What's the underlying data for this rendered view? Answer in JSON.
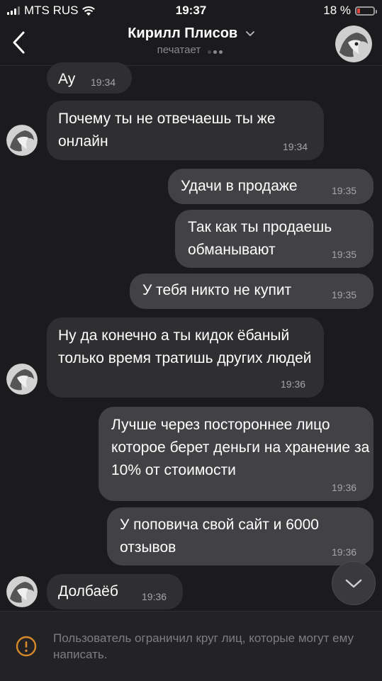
{
  "status_bar": {
    "carrier": "MTS RUS",
    "time": "19:37",
    "battery_text": "18 %",
    "battery_level": 0.18
  },
  "header": {
    "back_icon": "chevron-left-icon",
    "contact_name": "Кирилл Плисов",
    "status": "печатает",
    "avatar_icon": "contact-avatar"
  },
  "messages": [
    {
      "dir": "in",
      "text": "Ау",
      "time": "19:34"
    },
    {
      "dir": "in",
      "text": "Почему ты не отвечаешь ты же онлайн",
      "time": "19:34"
    },
    {
      "dir": "out",
      "text": "Удачи в продаже",
      "time": "19:35"
    },
    {
      "dir": "out",
      "text": "Так как ты продаешь обманывают",
      "time": "19:35"
    },
    {
      "dir": "out",
      "text": "У тебя никто не купит",
      "time": "19:35"
    },
    {
      "dir": "in",
      "text": "Ну да конечно а ты кидок ёбаный только время тратишь других людей",
      "time": "19:36"
    },
    {
      "dir": "out",
      "text": "Лучше через постороннее лицо которое берет деньги на хранение за 10% от стоимости",
      "time": "19:36"
    },
    {
      "dir": "out",
      "text": "У поповича свой сайт и 6000 отзывов",
      "time": "19:36"
    },
    {
      "dir": "in",
      "text": "Долбаёб",
      "time": "19:36"
    }
  ],
  "scroll_down_icon": "chevron-down-icon",
  "footer": {
    "warning_icon": "exclamation-circle-icon",
    "notice": "Пользователь ограничил круг лиц, которые могут ему написать."
  },
  "colors": {
    "background": "#1b1b1d",
    "incoming_bubble": "#2f2f31",
    "outgoing_bubble": "#424245",
    "warning": "#d8892b",
    "battery_low": "#e0473c"
  }
}
